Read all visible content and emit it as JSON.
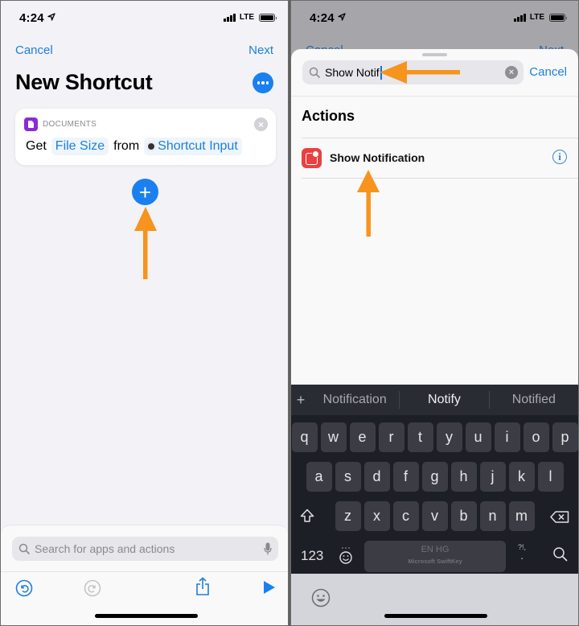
{
  "status_bar": {
    "time": "4:24",
    "network": "LTE"
  },
  "left_screen": {
    "nav": {
      "cancel": "Cancel",
      "next": "Next"
    },
    "title": "New Shortcut",
    "action_card": {
      "category": "DOCUMENTS",
      "verb": "Get",
      "param": "File Size",
      "connector": "from",
      "input": "Shortcut Input"
    },
    "search": {
      "placeholder": "Search for apps and actions"
    },
    "toolbar": [
      "undo-icon",
      "redo-icon",
      "share-icon",
      "play-icon"
    ]
  },
  "right_screen": {
    "search": {
      "value": "Show Notif",
      "cancel": "Cancel"
    },
    "section_title": "Actions",
    "results": [
      {
        "label": "Show Notification",
        "icon": "notification-icon"
      }
    ],
    "keyboard": {
      "suggestions": [
        "Notification",
        "Notify",
        "Notified"
      ],
      "rows": [
        [
          "q",
          "w",
          "e",
          "r",
          "t",
          "y",
          "u",
          "i",
          "o",
          "p"
        ],
        [
          "a",
          "s",
          "d",
          "f",
          "g",
          "h",
          "j",
          "k",
          "l"
        ],
        [
          "z",
          "x",
          "c",
          "v",
          "b",
          "n",
          "m"
        ]
      ],
      "numbers_key": "123",
      "space_lang": "EN HG",
      "space_brand": "Microsoft SwiftKey",
      "punct_key": "?!,"
    }
  },
  "colors": {
    "accent": "#1a80f0",
    "annotation_arrow": "#f7941d",
    "documents": "#8b2bd6",
    "notification": "#e84140"
  }
}
